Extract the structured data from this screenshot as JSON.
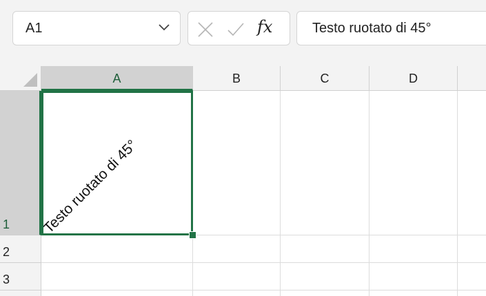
{
  "formula_bar": {
    "name_box_value": "A1",
    "fx_label": "fx",
    "formula_value": "Testo ruotato di 45°"
  },
  "columns": [
    "A",
    "B",
    "C",
    "D"
  ],
  "rows": [
    "1",
    "2",
    "3"
  ],
  "cells": {
    "A1": "Testo ruotato di 45°"
  },
  "colors": {
    "accent": "#217346",
    "header_bg": "#f3f3f3",
    "selected_header_bg": "#d2d2d2"
  },
  "icons": {
    "name_box_dropdown": "chevron-down-icon",
    "cancel": "close-icon",
    "enter": "check-icon",
    "insert_function": "fx-icon",
    "select_all": "select-all-triangle-icon"
  }
}
